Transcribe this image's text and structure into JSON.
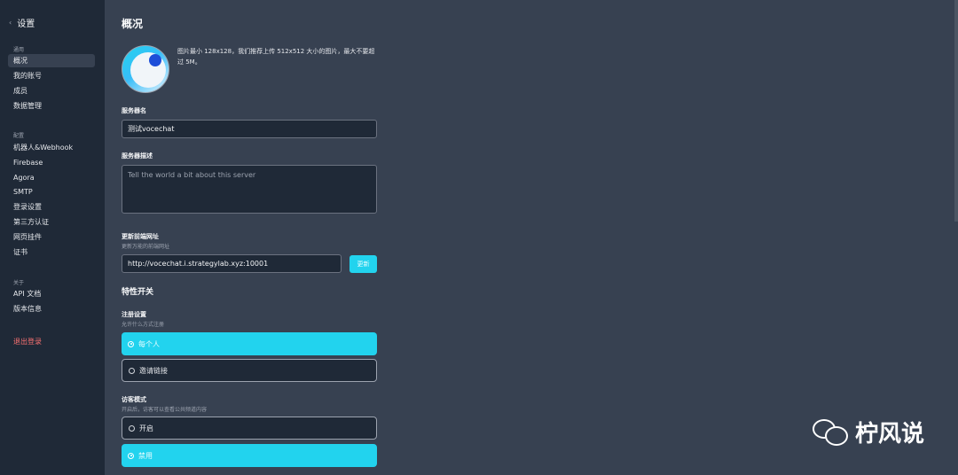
{
  "sidebar": {
    "title": "设置",
    "groups": {
      "general": {
        "label": "通用",
        "items": [
          "概况",
          "我的账号",
          "成员",
          "数据管理"
        ]
      },
      "config": {
        "label": "配置",
        "items": [
          "机器人&Webhook",
          "Firebase",
          "Agora",
          "SMTP",
          "登录设置",
          "第三方认证",
          "网页挂件",
          "证书"
        ]
      },
      "about": {
        "label": "关于",
        "items": [
          "API 文档",
          "版本信息"
        ]
      }
    },
    "logout": "退出登录"
  },
  "main": {
    "title": "概况",
    "avatar_hint": "图片最小 128x128，我们推荐上传 512x512 大小的图片，最大不要超过 5M。",
    "server_name": {
      "label": "服务器名",
      "value": "测试vocechat"
    },
    "server_desc": {
      "label": "服务器描述",
      "placeholder": "Tell the world a bit about this server"
    },
    "frontend_url": {
      "label": "更新前端网址",
      "sublabel": "更新万能的前端网址",
      "value": "http://vocechat.i.strategylab.xyz:10001",
      "button": "更新"
    },
    "features_title": "特性开关",
    "registration": {
      "label": "注册设置",
      "sublabel": "允许什么方式注册",
      "options": [
        {
          "label": "每个人",
          "selected": true
        },
        {
          "label": "邀请链接",
          "selected": false
        }
      ]
    },
    "guest_mode": {
      "label": "访客模式",
      "sublabel": "开启后，访客可以查看公共频道内容",
      "options": [
        {
          "label": "开启",
          "selected": false
        },
        {
          "label": "禁用",
          "selected": true
        }
      ]
    }
  },
  "watermark": {
    "text": "柠风说",
    "icon": "wechat-icon"
  },
  "colors": {
    "accent": "#22d3ee",
    "sidebar_bg": "#1f2937",
    "main_bg": "#374151",
    "danger": "#f87171"
  }
}
